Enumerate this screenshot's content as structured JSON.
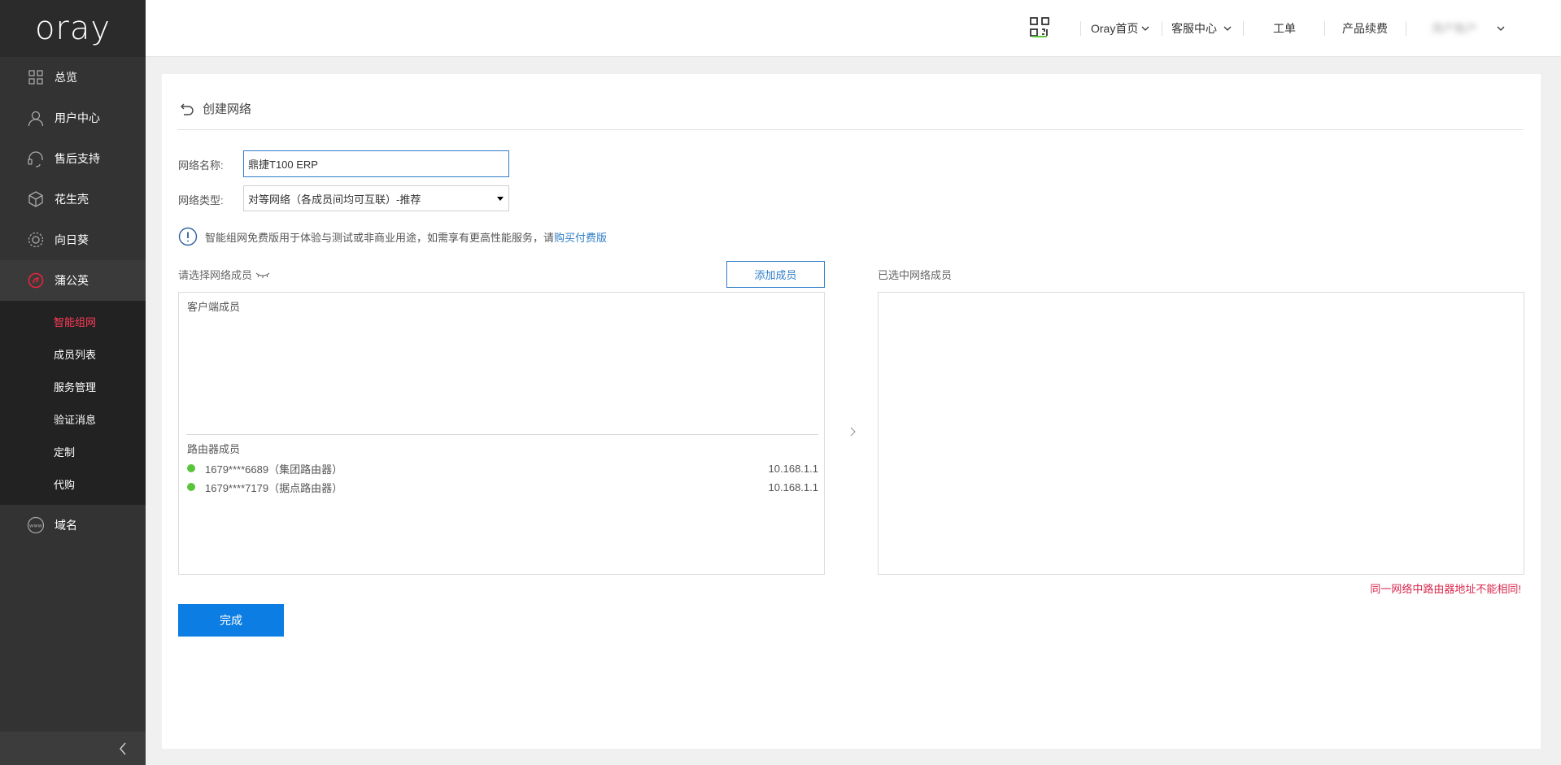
{
  "logo": "oray",
  "sidebar": {
    "items": [
      {
        "label": "总览",
        "icon": "grid-icon"
      },
      {
        "label": "用户中心",
        "icon": "user-icon"
      },
      {
        "label": "售后支持",
        "icon": "headset-icon"
      },
      {
        "label": "花生壳",
        "icon": "shell-icon"
      },
      {
        "label": "向日葵",
        "icon": "sunflower-icon"
      },
      {
        "label": "蒲公英",
        "icon": "dandelion-icon"
      }
    ],
    "sub_items": [
      {
        "label": "智能组网",
        "active": true
      },
      {
        "label": "成员列表"
      },
      {
        "label": "服务管理"
      },
      {
        "label": "验证消息"
      },
      {
        "label": "定制"
      },
      {
        "label": "代购"
      }
    ],
    "domain_item": {
      "label": "域名",
      "icon": "www-icon"
    }
  },
  "header": {
    "home_label": "Oray首页",
    "service_label": "客服中心",
    "ticket_label": "工单",
    "renew_label": "产品续费",
    "account_label": "用户账户"
  },
  "page": {
    "title": "创建网络",
    "name_label": "网络名称:",
    "name_value": "鼎捷T100 ERP",
    "type_label": "网络类型:",
    "type_value": "对等网络（各成员间均可互联）-推荐",
    "notice_text": "智能组网免费版用于体验与测试或非商业用途，如需享有更高性能服务，请",
    "notice_link": "购买付费版",
    "select_members_label": "请选择网络成员",
    "add_member_button": "添加成员",
    "selected_members_label": "已选中网络成员",
    "client_members_title": "客户端成员",
    "router_members_title": "路由器成员",
    "routers": [
      {
        "name": "1679****6689（集团路由器）",
        "ip": "10.168.1.1",
        "status_color": "#5ac43a"
      },
      {
        "name": "1679****7179（据点路由器）",
        "ip": "10.168.1.1",
        "status_color": "#5ac43a"
      }
    ],
    "error_message": "同一网络中路由器地址不能相同!",
    "done_button": "完成"
  },
  "colors": {
    "sidebar_bg": "#333333",
    "active_accent": "#ff3b58",
    "primary_blue": "#0c7ee3",
    "error_red": "#d9274b"
  }
}
